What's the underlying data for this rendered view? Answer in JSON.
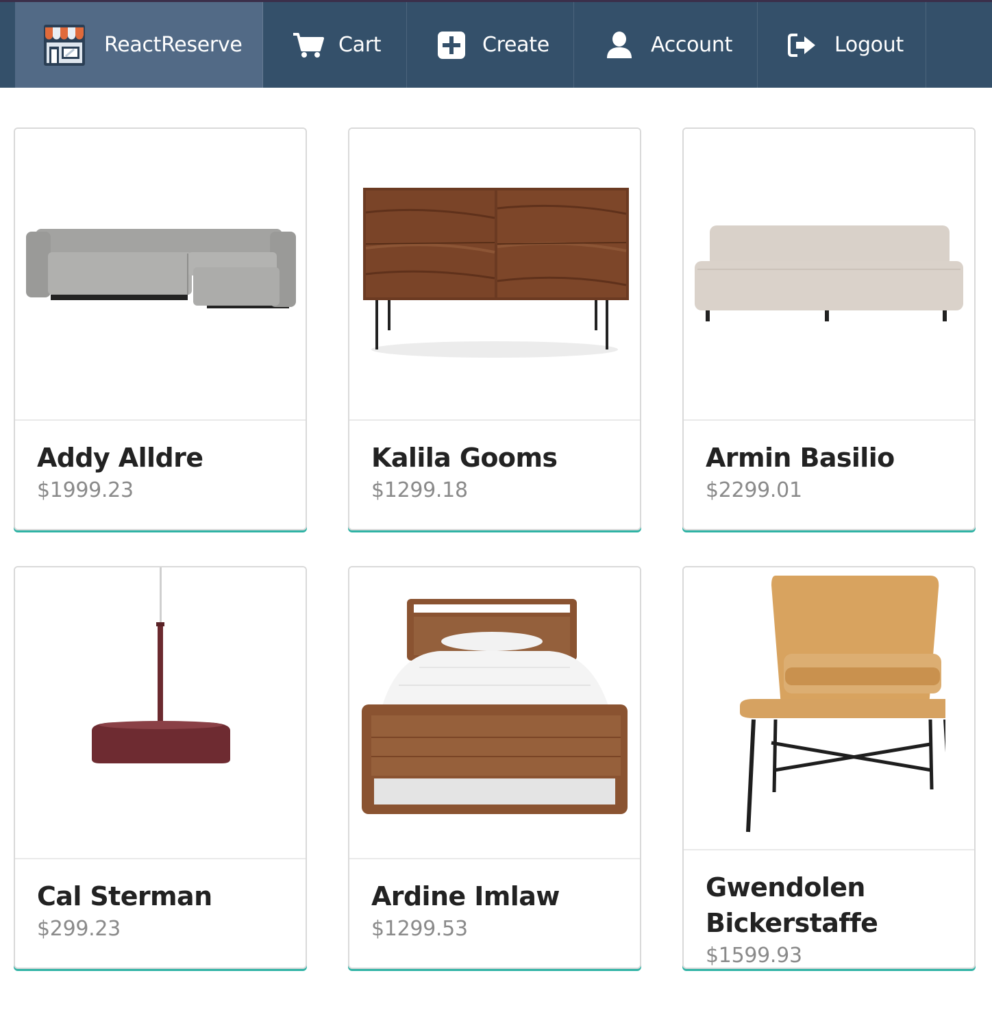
{
  "nav": {
    "brand": {
      "label": "ReactReserve",
      "icon": "storefront-icon"
    },
    "items": [
      {
        "label": "Cart",
        "icon": "cart-icon"
      },
      {
        "label": "Create",
        "icon": "plus-square-icon"
      },
      {
        "label": "Account",
        "icon": "user-icon"
      },
      {
        "label": "Logout",
        "icon": "sign-out-icon"
      }
    ]
  },
  "products": [
    {
      "name": "Addy Alldre",
      "price": "$1999.23",
      "image": "sectional-sofa"
    },
    {
      "name": "Kalila Gooms",
      "price": "$1299.18",
      "image": "walnut-dresser"
    },
    {
      "name": "Armin Basilio",
      "price": "$2299.01",
      "image": "armless-sofa"
    },
    {
      "name": "Cal Sterman",
      "price": "$299.23",
      "image": "pendant-lamp"
    },
    {
      "name": "Ardine Imlaw",
      "price": "$1299.53",
      "image": "wooden-bed"
    },
    {
      "name": "Gwendolen Bickerstaffe",
      "price": "$1599.93",
      "image": "leather-lounge-chair"
    }
  ],
  "colors": {
    "nav_bg": "#34506a",
    "nav_active": "#526a86",
    "card_accent": "#2fb3a5",
    "price_text": "#8a8a8a"
  }
}
